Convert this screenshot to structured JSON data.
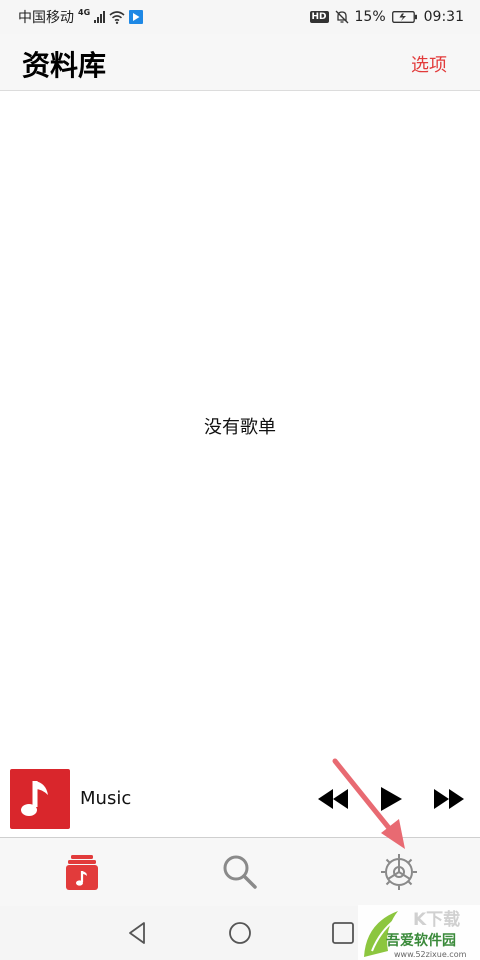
{
  "status_bar": {
    "carrier": "中国移动",
    "network": "4G",
    "battery": "15%",
    "time": "09:31",
    "icons": [
      "signal-icon",
      "wifi-icon",
      "location-icon",
      "hd-icon",
      "mute-bell-icon",
      "battery-icon"
    ]
  },
  "header": {
    "title": "资料库",
    "options_label": "选项"
  },
  "main": {
    "empty_message": "没有歌单"
  },
  "mini_player": {
    "track_title": "Music",
    "controls": [
      "rewind-icon",
      "play-icon",
      "fast-forward-icon"
    ]
  },
  "tab_bar": {
    "tabs": [
      {
        "name": "library",
        "icon": "library-icon",
        "active": true
      },
      {
        "name": "search",
        "icon": "search-icon",
        "active": false
      },
      {
        "name": "settings",
        "icon": "gear-icon",
        "active": false
      }
    ]
  },
  "nav_bar": {
    "buttons": [
      "back-icon",
      "home-icon",
      "recent-apps-icon"
    ]
  },
  "watermark": {
    "name": "吾爱软件园",
    "url": "www.52zixue.com"
  },
  "colors": {
    "accent": "#e23b3b",
    "album_art": "#d9262c",
    "annotation_arrow": "#e86a72",
    "icon_gray": "#8a8a8a"
  }
}
